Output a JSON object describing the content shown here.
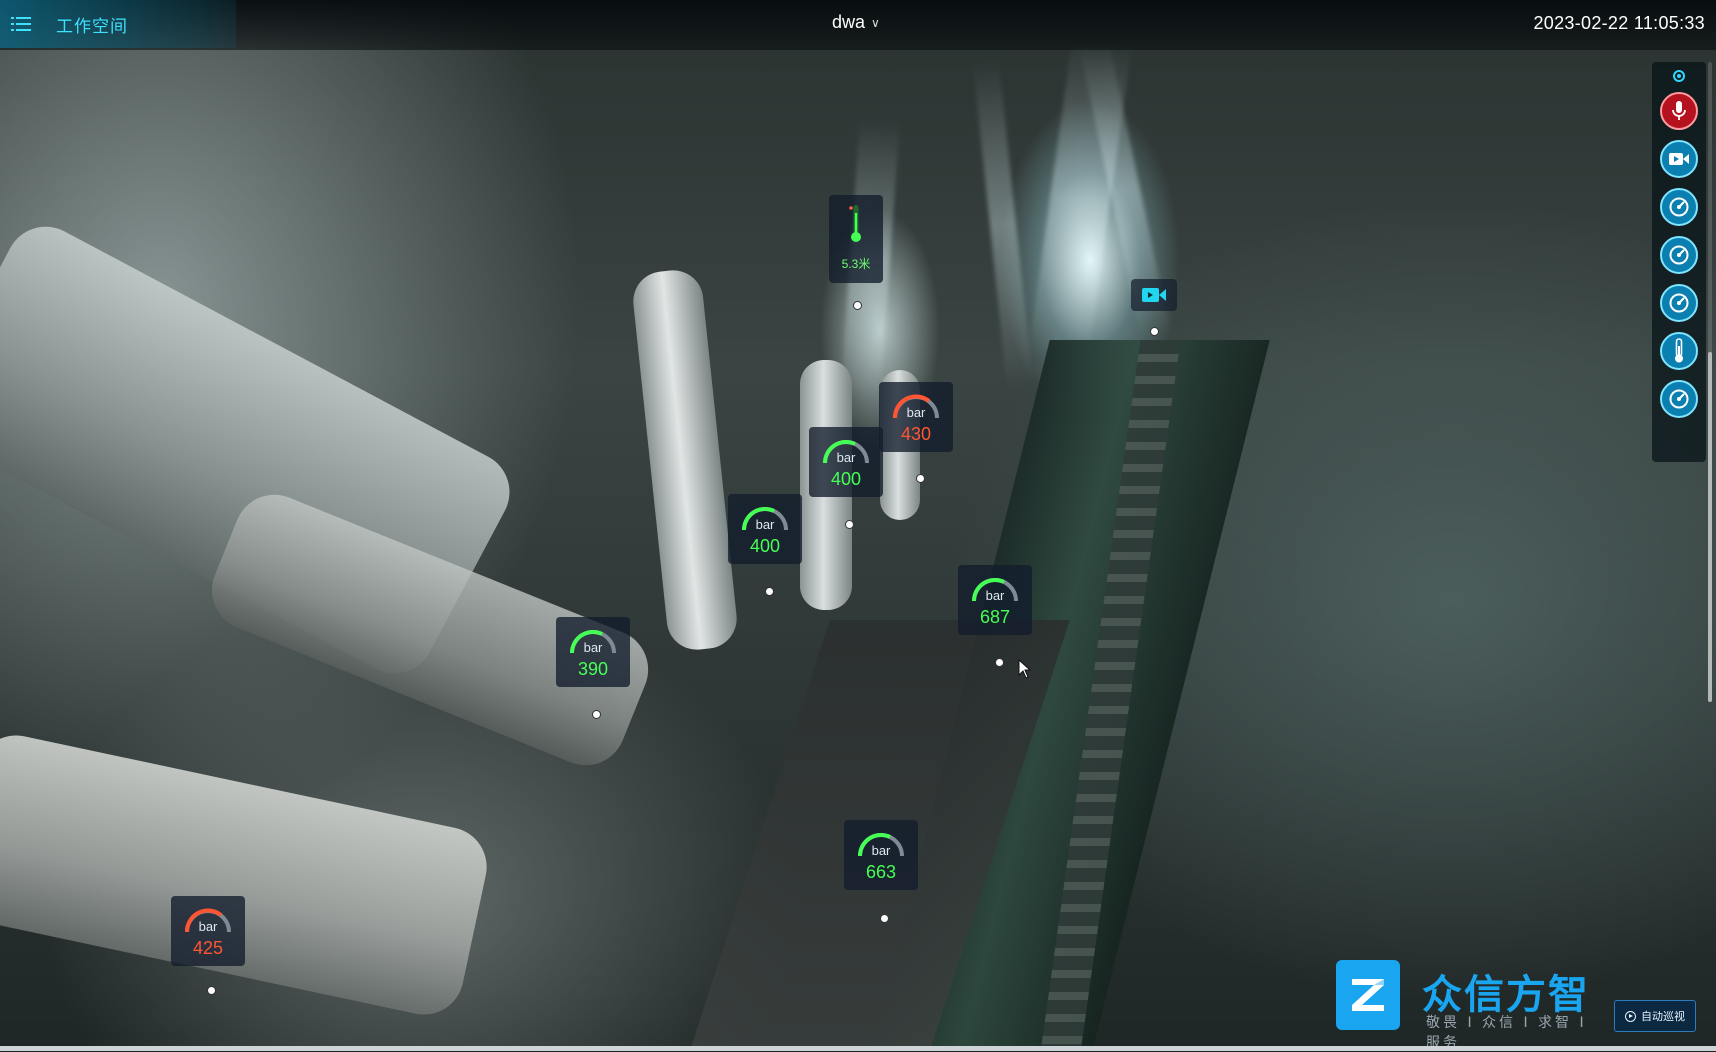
{
  "header": {
    "workspace_label": "工作空间",
    "scene_name": "dwa",
    "datetime": "2023-02-22 11:05:33"
  },
  "toolbar": {
    "buttons": [
      {
        "name": "microphone",
        "icon": "microphone-icon",
        "color": "#b5121f"
      },
      {
        "name": "video-camera",
        "icon": "video-camera-icon",
        "color": "#0a7fb0"
      },
      {
        "name": "pressure-gauge-1",
        "icon": "gauge-icon",
        "color": "#0a7fb0"
      },
      {
        "name": "pressure-gauge-2",
        "icon": "gauge-icon",
        "color": "#0a7fb0"
      },
      {
        "name": "pressure-gauge-3",
        "icon": "gauge-icon",
        "color": "#0a7fb0"
      },
      {
        "name": "thermometer",
        "icon": "thermometer-icon",
        "color": "#0a7fb0"
      },
      {
        "name": "pressure-gauge-4",
        "icon": "gauge-icon",
        "color": "#0a7fb0"
      }
    ]
  },
  "sensors": {
    "thermometer_value": "5.3米",
    "gauges": [
      {
        "unit": "bar",
        "value": "430",
        "status": "red"
      },
      {
        "unit": "bar",
        "value": "400",
        "status": "green"
      },
      {
        "unit": "bar",
        "value": "400",
        "status": "green"
      },
      {
        "unit": "bar",
        "value": "687",
        "status": "green"
      },
      {
        "unit": "bar",
        "value": "390",
        "status": "green"
      },
      {
        "unit": "bar",
        "value": "663",
        "status": "green"
      },
      {
        "unit": "bar",
        "value": "425",
        "status": "red"
      }
    ]
  },
  "brand": {
    "name": "众信方智",
    "slogan": "敬畏 I 众信 I 求智 I 服务"
  },
  "auto_patrol_label": "自动巡视",
  "colors": {
    "accent": "#3fe0ff",
    "gauge_green": "#46ff55",
    "gauge_red": "#ff5533",
    "brand_blue": "#1aa5f0"
  }
}
